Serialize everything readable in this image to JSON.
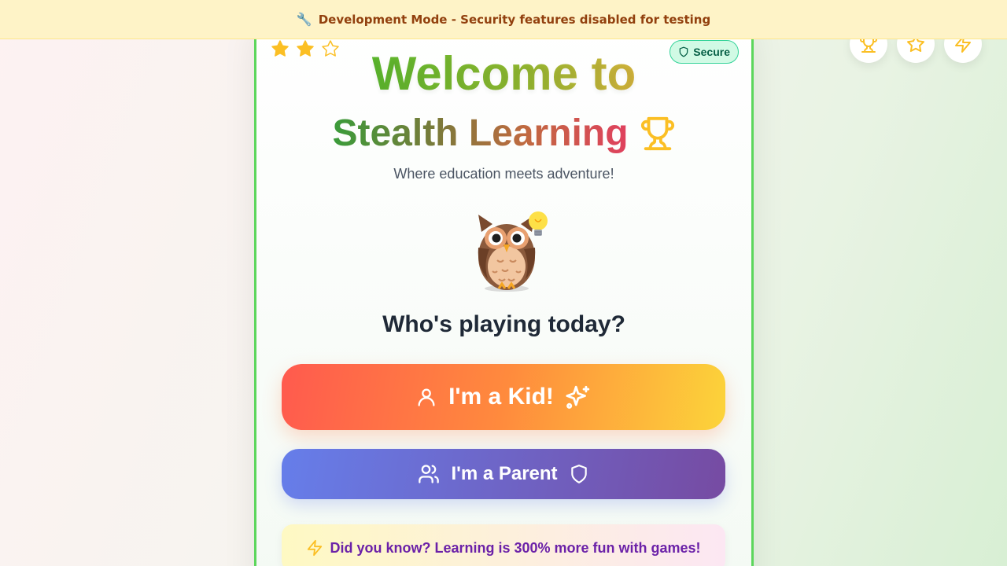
{
  "banner": {
    "icon": "wrench-icon",
    "icon_glyph": "🔧",
    "text": "Development Mode - Security features disabled for testing"
  },
  "corner_buttons": [
    {
      "name": "trophy-button",
      "icon": "trophy-icon"
    },
    {
      "name": "star-button",
      "icon": "star-icon"
    },
    {
      "name": "zap-button",
      "icon": "zap-icon"
    }
  ],
  "card": {
    "rating": {
      "filled": 2,
      "total": 3
    },
    "secure_badge": "Secure",
    "welcome": "Welcome to",
    "title": "Stealth Learning",
    "tagline": "Where education meets adventure!",
    "question": "Who's playing today?",
    "kid_button": "I'm a Kid!",
    "parent_button": "I'm a Parent",
    "fact": "Did you know? Learning is 300% more fun with games!"
  },
  "colors": {
    "accent_green": "#5cd65c",
    "banner_bg": "#fef3c7",
    "banner_text": "#92400e",
    "kid_gradient": [
      "#ff5a4e",
      "#fcd43a"
    ],
    "parent_gradient": [
      "#667eea",
      "#764ba2"
    ],
    "fact_text": "#6b21a8",
    "gold": "#fbbf24"
  }
}
